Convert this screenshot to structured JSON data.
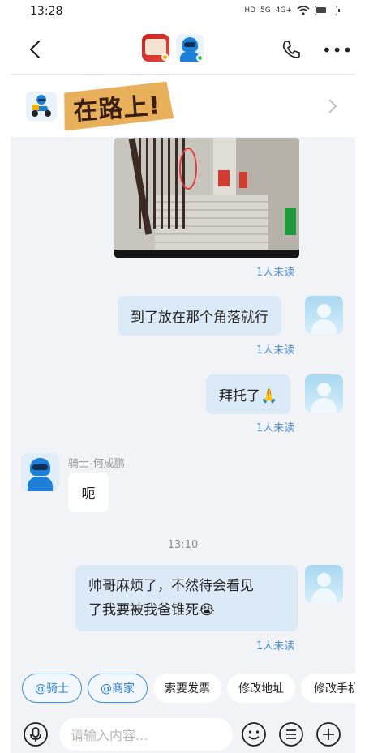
{
  "status_bar": {
    "time": "13:28",
    "signal_icons": [
      "HD",
      "5G",
      "4G+"
    ],
    "wifi_icon": "wifi-icon",
    "battery_icon": "battery-icon"
  },
  "nav": {
    "back_icon": "chevron-left-icon",
    "phone_icon": "phone-icon",
    "more_icon": "more-icon",
    "more_label": "•••"
  },
  "banner": {
    "title": "在路上!",
    "arrow_icon": "chevron-right-icon"
  },
  "messages": [
    {
      "type": "image",
      "direction": "out",
      "read_status": "1人未读"
    },
    {
      "type": "text",
      "direction": "out",
      "text": "到了放在那个角落就行",
      "read_status": "1人未读"
    },
    {
      "type": "text",
      "direction": "out",
      "text": "拜托了🙏",
      "read_status": "1人未读"
    },
    {
      "type": "text",
      "direction": "in",
      "sender": "骑士-何成鹏",
      "text": "呃"
    },
    {
      "type": "time",
      "text": "13:10"
    },
    {
      "type": "text",
      "direction": "out",
      "line1": "帅哥麻烦了，不然待会看见",
      "line2": "了我要被我爸锥死😭",
      "read_status": "1人未读"
    }
  ],
  "quick_actions": [
    "@骑士",
    "@商家",
    "索要发票",
    "修改地址",
    "修改手机"
  ],
  "input": {
    "placeholder": "请输入内容...",
    "voice_icon": "microphone-icon",
    "emoji_icon": "emoji-icon",
    "menu_icon": "list-icon",
    "add_icon": "plus-icon"
  },
  "colors": {
    "accent": "#2d7fd6",
    "outgoing_bubble": "#dceaf8",
    "read_status": "#4a8fd1",
    "background": "#f2f3f7"
  }
}
